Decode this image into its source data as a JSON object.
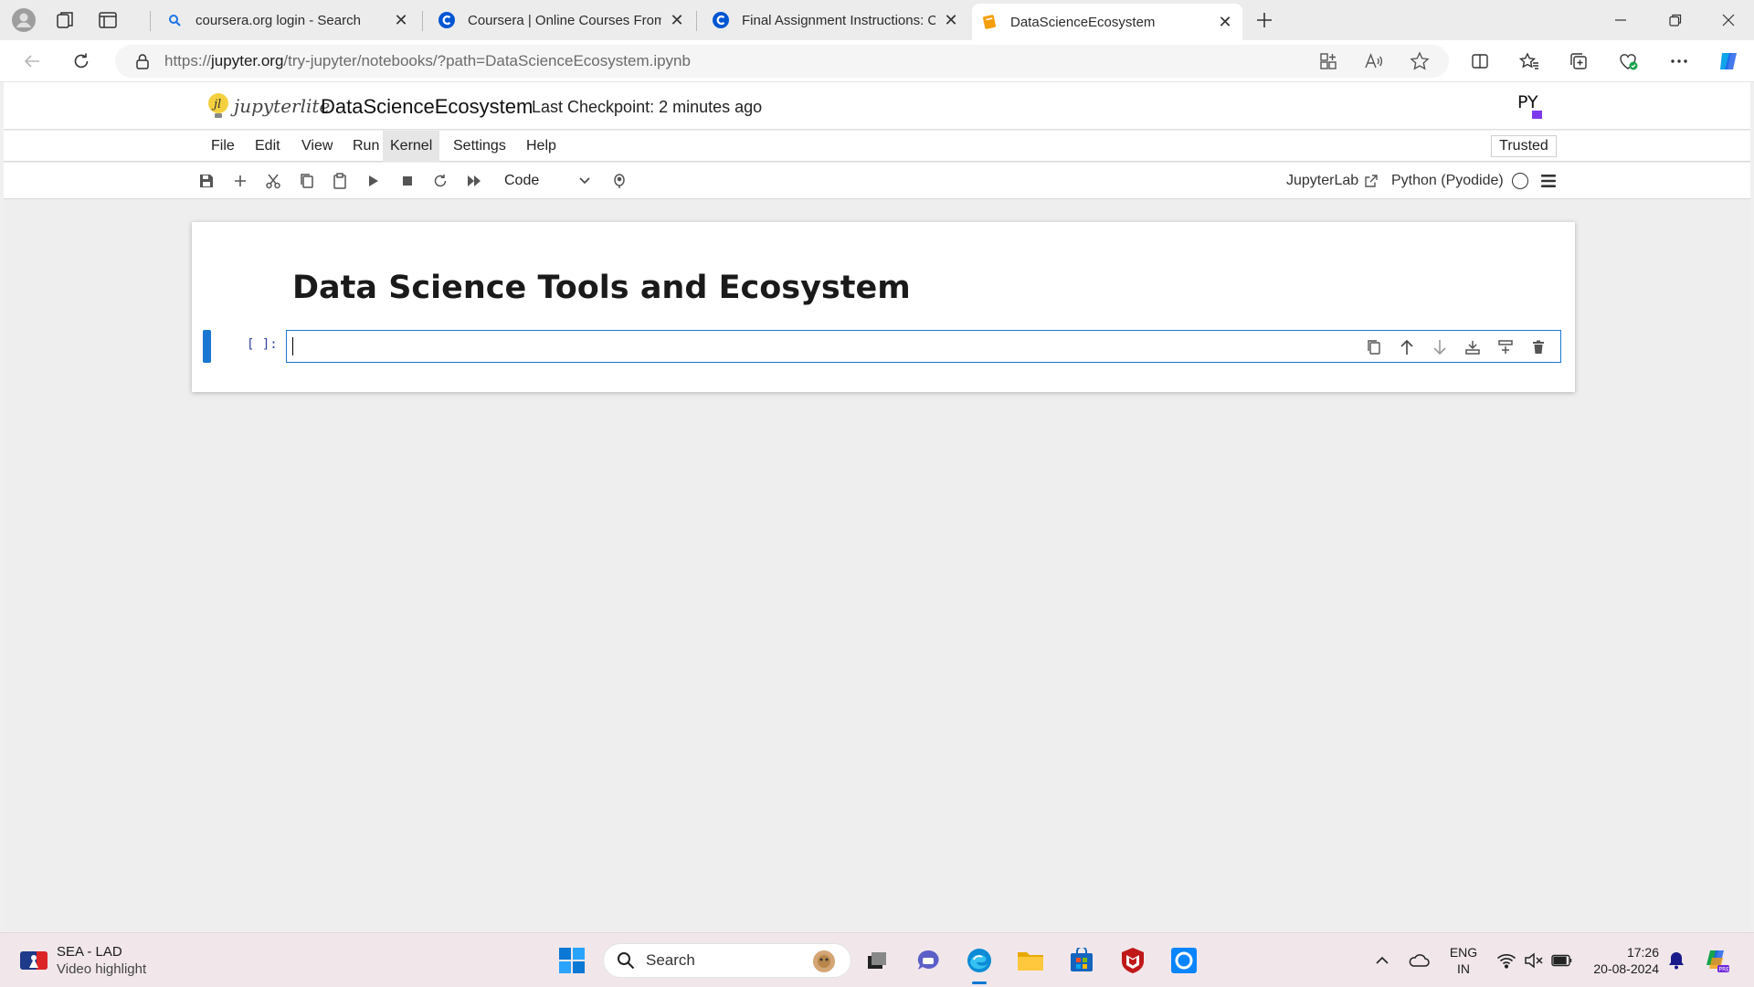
{
  "browser": {
    "tabs": [
      {
        "title": "coursera.org login - Search",
        "favicon": "search-icon"
      },
      {
        "title": "Coursera | Online Courses From T",
        "favicon": "coursera-icon"
      },
      {
        "title": "Final Assignment Instructions: Cr",
        "favicon": "coursera-icon"
      },
      {
        "title": "DataScienceEcosystem",
        "favicon": "notebook-icon"
      }
    ],
    "url_prefix": "https://",
    "url_host": "jupyter.org",
    "url_path": "/try-jupyter/notebooks/?path=DataScienceEcosystem.ipynb"
  },
  "jupyter": {
    "logo_text": "jupyterlite",
    "notebook_name": "DataScienceEcosystem",
    "checkpoint": "Last Checkpoint: 2 minutes ago",
    "py_logo": "PY",
    "menu": [
      "File",
      "Edit",
      "View",
      "Run",
      "Kernel",
      "Settings",
      "Help"
    ],
    "trusted": "Trusted",
    "cell_type": "Code",
    "jupyterlab_link": "JupyterLab",
    "kernel": "Python (Pyodide)"
  },
  "notebook": {
    "heading": "Data Science Tools and Ecosystem",
    "code_prompt": "[ ]:"
  },
  "taskbar": {
    "news_title": "SEA - LAD",
    "news_sub": "Video highlight",
    "search_label": "Search",
    "lang_top": "ENG",
    "lang_bottom": "IN",
    "time": "17:26",
    "date": "20-08-2024"
  },
  "colors": {
    "accent": "#1976d2",
    "edge_blue": "#0078d4"
  }
}
